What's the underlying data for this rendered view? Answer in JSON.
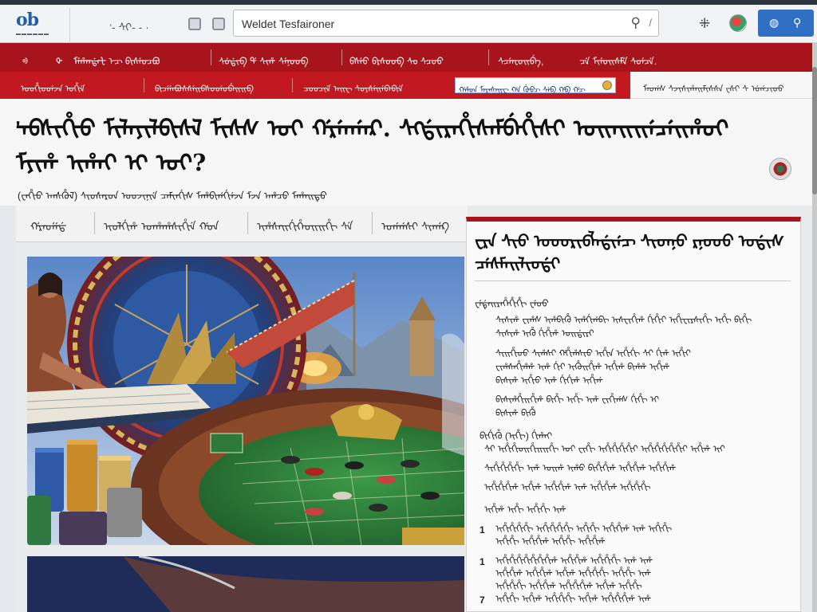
{
  "browser": {
    "logo": "ob",
    "nav_glyphs": "ᡃ- ᠰᠢ- - ·",
    "address_text": "Weldet Tesfaironer",
    "address_end": "/"
  },
  "top_nav": {
    "items": [
      "ᢀ",
      "ᡐ",
      "ᠮᡝᡥᠠᠨᡩᠠᡶ ᡝᠴ ᠪᡳᠰᡝᡠᠴᠪᠣ",
      "ᠰᡠᡩᡳᠪ ᡩ ᠰᡳᡥ ᠰᡝᠨᠣᡠᠪ",
      "ᠪᠰᡝᡠ ᠪᠷᠰᠣᡠᠪ ᠰᠣ ᠰᠴᠣᡠ",
      "ᠰᠴᡝᠠᡶᠣᡳᠪᡝ,",
      "ᠴᡝ ᠮᡳᡝᡠᡳᠰᠮᡝ ᠰᠣᡝᠴᡝ."
    ]
  },
  "sub_nav": {
    "items": [
      "ᠣᡠᡥᡳᡠᡠᡝᠵᠠ ᠣᡥᡳᡝ",
      "ᠪᡳᠴᡝᡝᠠᠪᠣᠰᠰᡝᡳᠪᠰᠣᡠᡝᡠᠪᡝᡳᡳᠪ",
      "ᠴᠣᡠᠴᡳᡝ ᠠᡳᠸ ᠰᠣᠶᠰᡝᡳᡝᠪᠠᠪᡳᡝ"
    ],
    "promo": "ᡤᡥᡨ ᠮᠠᠷᠠᠰᠠᡳᠸ ᡤᠠ ᡤᡠᠪᠴ ᠰᡝᠪ ᡤᠪ ᡤᠴ",
    "right": "ᠮᠠᡠᡤᠰ ᠰᠵᡳᠰᡳᡥᠠᡳᠮᡳᠰᠰᠠ ᠸᠰᠶ ᠰ ᡠᡤᠴᡳᡠᠣ"
  },
  "article": {
    "headline": "ᡃᠠᠪᠰᡳᡥᡳᠣ ᠮᠢᠯᠠᠶᠢᠯᠪᡳᠰᠯ ᠮᠢᠰᠰ ᠣᡳ ᡤᠷᡝᠠᡤᠠᠷ. ᠰᠬᡩᡳᠷᠠᡥᡳᠰᠠᠮᠪᡝᡥᡳᠰᡳ ᠣᡳᠠᡳᡳᡝᠴᡝᡳᡥᠣᡳ ᠮᠶᡳᡥ ᡳᡥᠠᡳ ᡳ ᠣᡳ?",
    "byline": "(ᠸᠠᡥᡳᡠ ᠠᠨᠰᡥᡠᠯ) ᠰᡳᠣᠰᠡᠷᡨ ᠣᡠᠵᡳᠨᡳᡝ ᠴᠠᠮᡳᠨᡤᡳᠰ ᠮᠡᡥᠪᡳᡤᡤᡳᡝᠵᠠ ᠮᠵᠠ ᠠᡥᠴᠣ ᠮᠡᡥᠠᡳᡨᡠ"
  },
  "tabs": [
    "ᡤᠷᠠᡠᡝᡝᡩ",
    "ᡳᡠᠯᡤᡳᡥ ᠣᠠᡥᠠᡥᠰᡳᡥᡳᡝ ᡤᠣᠠ",
    "ᡳᡥᠰᠠᡳᡤᡳᡥᡝᠣᡳᡳᡥᡳ ᠰᡝ",
    "ᠣᡤᡤᠰᡳ ᠰᡳᠠᡤᠺ"
  ],
  "panel": {
    "title": "ᠸᠷᠠ ᠰᡳᡠ ᠣᠣᡠᠷᡳᠪᠯᠠᡩᡳᡝᠴ ᠰᡳᡨᠨᠣ ᠷᠨᠣᠣᡠ ᠣᡩᡳᠰ ᠴᡝᠰᠮᠠᡳᠯᡳᡠᡩᡳ",
    "label": "ᠸᡝᡩᡝᡳᠷᠠᡥᡝᡥᡳᡥᡳ ᠸᡝᠣᡠ",
    "para1": [
      "ᠰᡳᠰᡳᡥ ᠸᡳᡥᠰ ᡳᡥᠪᡳᡥᡠ ᡳᡥᡤᡳᡤᠪᡳ ᡳᠰᠸᡳᡥᡳᡥ ᡤᡳᡥᡳᡳ ᡳᡥᡳᠸᡳᠷᠰᡳᡥᡳ ᡳᡥᡳ ᠪᡳᡥᡳ",
      "ᠰᡳᠰᡳᡥ ᡳᡥᡠ ᡤᡳᡥᡳᡥ ᠣᡳᡩᡳᠷᡳ"
    ],
    "para2": [
      "ᠰᡳᡳᡥᡳᡠᡠ ᠰᡳᡥᠰᡳ ᡤᡥᡳᡥᠰᡳᡠ ᡳᡥᡳᠠ ᡳᡥᡳᡤᡳ ᠰᡳ ᡤᡳᡥ ᡳᡥᡳᡳ",
      "ᠸᡳᡥᠰᠠᡥᡳᡥᡥ ᡳᡥ ᡤᡳᡳ ᡳᡥᡠᡳᡥᡳᡥ ᡳᡥᡳᡥ ᠪᡳᡥᡥ ᡳᡥᡳᡥ",
      "ᠪᡳᠰᡳᡥ ᡳᡥᡳᡠ ᡳᡥ ᡤᡳᡤᡳᡥ ᡳᡥᡳᡤ"
    ],
    "para3": [
      "ᠪᡳᠰᡳᡥᡥᡳᡳᡥᡳᡥ ᠪᡳᡥᡳ ᡳᡥᡳ ᡳᡥ ᠸᡳᡥᡳᡤᠰ ᡤᡳᡥᡳ ᡳ",
      "ᠪᡳᠰᡳᡥ ᠪᡳᡥᡠ"
    ],
    "subhead": "ᠪᡳᡤᡳᡥᡠ (ᡳᡥᡳ) ᡤᡳᡥᠠᡳ",
    "para4": [
      "ᠰᡳ ᡳᡥᡳᡥᡳᡠᡳᡥᡳᡳᡳᡥᡳ ᠣᡳ ᠸᡳᡥᡳ ᡳᡥᡳᡥᡳᡥᡳᡥᡳᡳ ᡳᡥᡳᡥᡳᡥᡳᡥᡳᡥᡳᡳ ᡳᡥᡳᡥ ᡳᡳ",
      "ᠰᡳᡥᡳᡥᡳᡥᡳᡥᡳ ᡳᡥ ᠣᡳᡥ ᡳᡥᠣ ᠪᡳᡥᡳᡥᡳᡥ ᡳᡥᡳᡥᡳᡥ ᡳᡥᡳᡥᡳᡥ",
      "ᡳᡥᡳᡥᡳᡥᡳᡥ ᡳᡥᡳᡥ ᡳᡥᡳᡥᡳᡥ ᡳᡥ ᡳᡥᡳᡥᡳᡥ ᡳᡥᡳᡥᡳᡥᡳ"
    ],
    "list_intro": "ᡳᡥᡳᡥ ᡳᡥᡳ ᡳᡥᡳᡥᡳ ᡳᡥ",
    "list": [
      {
        "num": "1",
        "lines": [
          "ᡳᡥᡳᡥᡳᡥᡳᡥᡳ ᡳᡥᡳᡥᡳᡥᡳᡥᡳ ᡳᡥᡳᡥᡳ ᡳᡥᡳᡥᡳᡥ ᡳᡥ ᡳᡥᡳᡥᡳ",
          "ᡳᡥᡳᡥᡳ ᡳᡥᡳᡥᡳᡥ ᡳᡥᡳᡥᡳ ᡳᡥᡳᡥᡳᡥ"
        ]
      },
      {
        "num": "1",
        "lines": [
          "ᡳᡥᡳᡥᡳᡥᡳᡥᡳᡥᡳᡥᡳᡥᡳᡥ ᡳᡥᡳᡥᡳᡥ ᡳᡥᡳᡥᡳᡥᡳ ᡳᡥ ᡳᡥ",
          "ᡳᡥᡳᡥᡳᡥ ᡳᡥᡳᡥᡳᡥ ᡳᡥᡳᡥ ᡳᡥᡳᡥᡳᡥᡳ ᡳᡥᡳᡥᡳ ᡳᡥ",
          "ᡳᡥᡳᡥᡳᡥᡳ ᡳᡥᡳᡥᡳᡥ ᡳᡥᡳᡥᡳᡥᡳᡥ ᡳᡥᡳᡥ ᡳᡥᡳᡥᡳ"
        ]
      },
      {
        "num": "7",
        "lines": [
          "ᡳᡥᡳᡥᡳ ᡳᡥᡳᡥ ᡳᡥᡳᡥᡳᡥᡳ ᡳᡥᡳᡥ ᡳᡥᡳᡥᡳᡥᡳᡥ ᡳᡥ",
          "ᡳᡥᡳᡥᡳᡥ ᡳᡥᡳᡥᡳᡥᡳ ᡳᡥᡳᡥᡳᡥ ᡳᡥᡳ"
        ]
      }
    ]
  },
  "colors": {
    "brand_red": "#a8141b",
    "sub_red": "#c2181f",
    "link_blue": "#2f6fc4"
  },
  "icons": [
    "back-glyph-icon",
    "search-icon",
    "grid-icon",
    "extension-icon",
    "shield-icon",
    "share-icon"
  ]
}
